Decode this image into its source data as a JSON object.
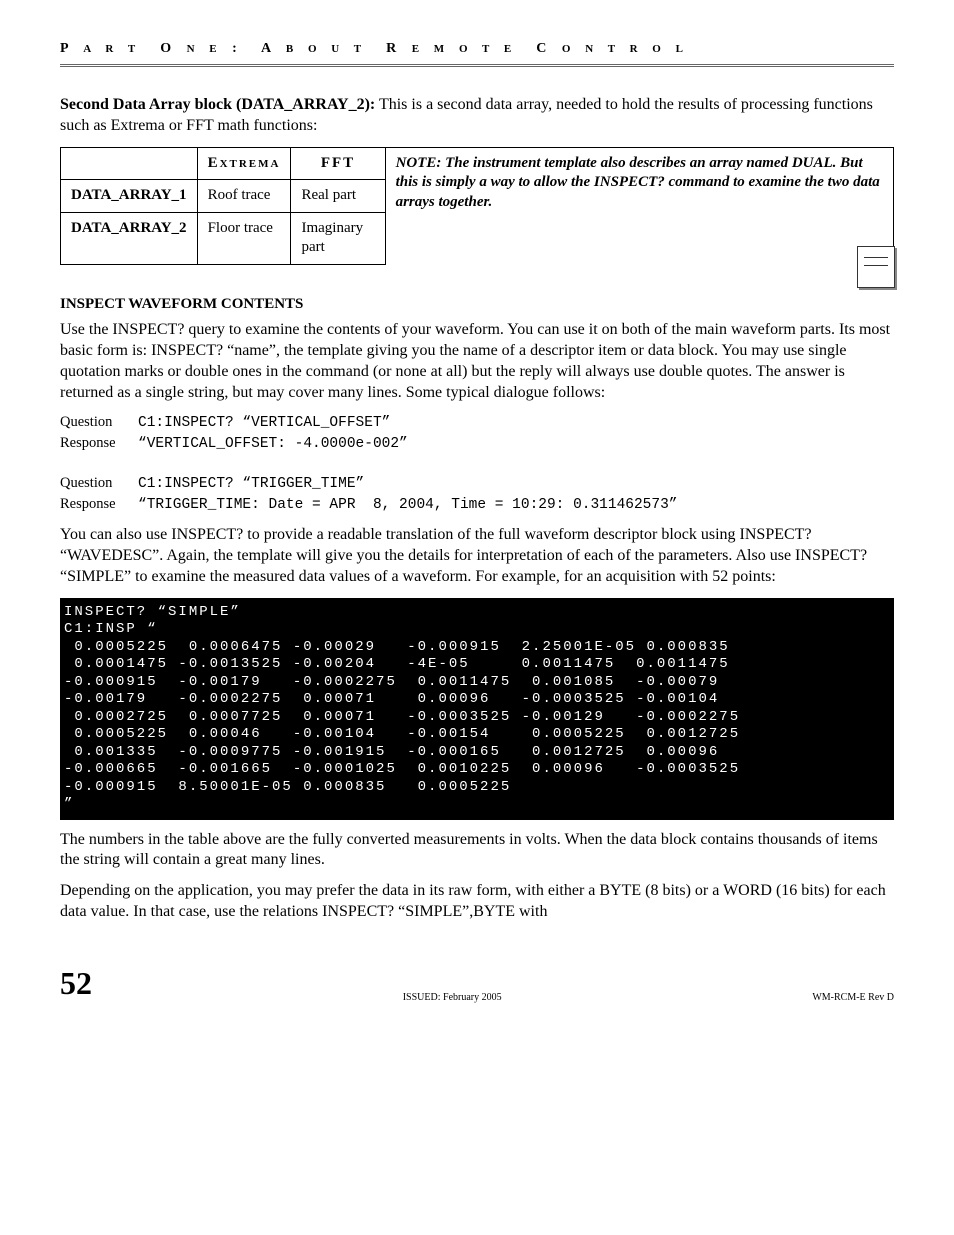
{
  "running_head": "P ART  O NE :  A BOUT  R EMOTE  C ONTROL",
  "intro": {
    "lead": "Second Data Array block (DATA_ARRAY_2):",
    "rest": " This is a second data array, needed to hold the results of processing functions such as Extrema or FFT math functions:"
  },
  "table": {
    "headers": [
      "",
      "EXTREMA",
      "FFT"
    ],
    "rows": [
      {
        "label": "DATA_ARRAY_1",
        "extrema": "Roof trace",
        "fft": "Real part"
      },
      {
        "label": "DATA_ARRAY_2",
        "extrema": "Floor trace",
        "fft": "Imaginary part"
      }
    ],
    "note": {
      "bold": "NOTE: The instrument template also describes an array named DUAL. But this is simply a way to allow the INSPECT?  command to examine the two data arrays together."
    }
  },
  "section_head": "INSPECT WAVEFORM CONTENTS",
  "para1": "Use the INSPECT? query to examine the contents of your waveform. You can use it on both of the main waveform parts. Its most basic form is: INSPECT? “name”, the template giving you the name of a descriptor item or data block. You may use single quotation marks or double ones in the command (or none at all) but the reply will always use double quotes. The answer is returned as a single string, but may cover many lines. Some typical dialogue follows:",
  "qa": [
    {
      "label": "Question",
      "text": "C1:INSPECT? “VERTICAL_OFFSET”"
    },
    {
      "label": "Response",
      "text": "“VERTICAL_OFFSET: -4.0000e-002”"
    },
    {
      "label": "",
      "text": ""
    },
    {
      "label": "Question",
      "text": "C1:INSPECT? “TRIGGER_TIME”"
    },
    {
      "label": "Response",
      "text": "“TRIGGER_TIME: Date = APR  8, 2004, Time = 10:29: 0.311462573”"
    }
  ],
  "para2": "You can also use INSPECT? to provide a readable translation of the full waveform descriptor block using INSPECT? “WAVEDESC”. Again, the template will give you the details for interpretation of each of the parameters. Also use INSPECT? “SIMPLE” to examine the measured data values of a waveform. For example, for an acquisition with 52 points:",
  "terminal": "INSPECT? “SIMPLE”\nC1:INSP “\n 0.0005225  0.0006475 -0.00029   -0.000915  2.25001E-05 0.000835\n 0.0001475 -0.0013525 -0.00204   -4E-05     0.0011475  0.0011475\n-0.000915  -0.00179   -0.0002275  0.0011475  0.001085  -0.00079\n-0.00179   -0.0002275  0.00071    0.00096   -0.0003525 -0.00104\n 0.0002725  0.0007725  0.00071   -0.0003525 -0.00129   -0.0002275\n 0.0005225  0.00046   -0.00104   -0.00154    0.0005225  0.0012725\n 0.001335  -0.0009775 -0.001915  -0.000165   0.0012725  0.00096\n-0.000665  -0.001665  -0.0001025  0.0010225  0.00096   -0.0003525\n-0.000915  8.50001E-05 0.000835   0.0005225\n”",
  "para3": "The numbers in the table above are the fully converted measurements in volts. When the data block contains thousands of items the string will contain a great many lines.",
  "para4": "Depending on the application, you may prefer the data in its raw form, with either a BYTE (8 bits) or a WORD (16 bits) for each data value. In that case, use the relations INSPECT? “SIMPLE”,BYTE with",
  "footer": {
    "page": "52",
    "center": "ISSUED: February 2005",
    "right": "WM-RCM-E Rev D"
  }
}
